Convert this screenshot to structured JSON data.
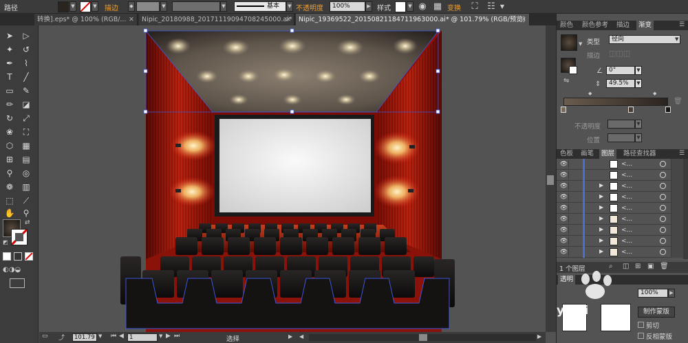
{
  "control_bar": {
    "object_label": "路径",
    "stroke_label": "描边",
    "stroke_style_label": "基本",
    "opacity_label": "不透明度",
    "opacity_value": "100%",
    "style_label": "样式",
    "transform_label": "变换"
  },
  "document_tabs": [
    {
      "label": "转换].eps* @ 100% (RGB/..."
    },
    {
      "label": "Nipic_20180988_20171119094708245000.ai*"
    },
    {
      "label": "Nipic_19369522_20150821184711963000.ai* @ 101.79% (RGB/预览)"
    }
  ],
  "gradient_panel": {
    "tabs": [
      "颜色",
      "颜色参考",
      "描边",
      "渐变"
    ],
    "type_label": "类型",
    "type_value": "径向",
    "stroke_label": "描边",
    "angle_value": "0°",
    "aspect_value": "49.5%",
    "opacity_label": "不透明度",
    "location_label": "位置"
  },
  "layers_panel": {
    "tabs": [
      "色板",
      "画笔",
      "图层",
      "路径查找器"
    ],
    "rows": [
      {
        "name": "<...",
        "thumb": "#ffffff",
        "arrow": ""
      },
      {
        "name": "<...",
        "thumb": "#ffffff",
        "arrow": ""
      },
      {
        "name": "<...",
        "thumb": "#ffffff",
        "arrow": "▶"
      },
      {
        "name": "<...",
        "thumb": "#ffffff",
        "arrow": "▶"
      },
      {
        "name": "<...",
        "thumb": "#ffffff",
        "arrow": "▶"
      },
      {
        "name": "<...",
        "thumb": "#f2e8d8",
        "arrow": "▶"
      },
      {
        "name": "<...",
        "thumb": "#f2e8d8",
        "arrow": "▶"
      },
      {
        "name": "<...",
        "thumb": "#f2e8d8",
        "arrow": "▶"
      },
      {
        "name": "<...",
        "thumb": "#f2e8d8",
        "arrow": "▶"
      }
    ],
    "footer_count": "1 个图层"
  },
  "transparency_panel": {
    "tab": "透明",
    "opacity_value": "100%",
    "make_mask_button": "制作蒙版",
    "clip_label": "剪切",
    "invert_mask_label": "反相蒙版"
  },
  "status_bar": {
    "zoom_value": "101.79",
    "page_value": "1",
    "tool_label": "选择"
  },
  "canvas": {
    "watermark": "yanji"
  },
  "colors": {
    "ui_dark": "#3b3b3b",
    "canvas_gray": "#535353",
    "selection_blue": "#3d57d8",
    "curtain_red": "#b01a10",
    "screen_white": "#f2f2f2",
    "accent_orange": "#f0a030"
  }
}
